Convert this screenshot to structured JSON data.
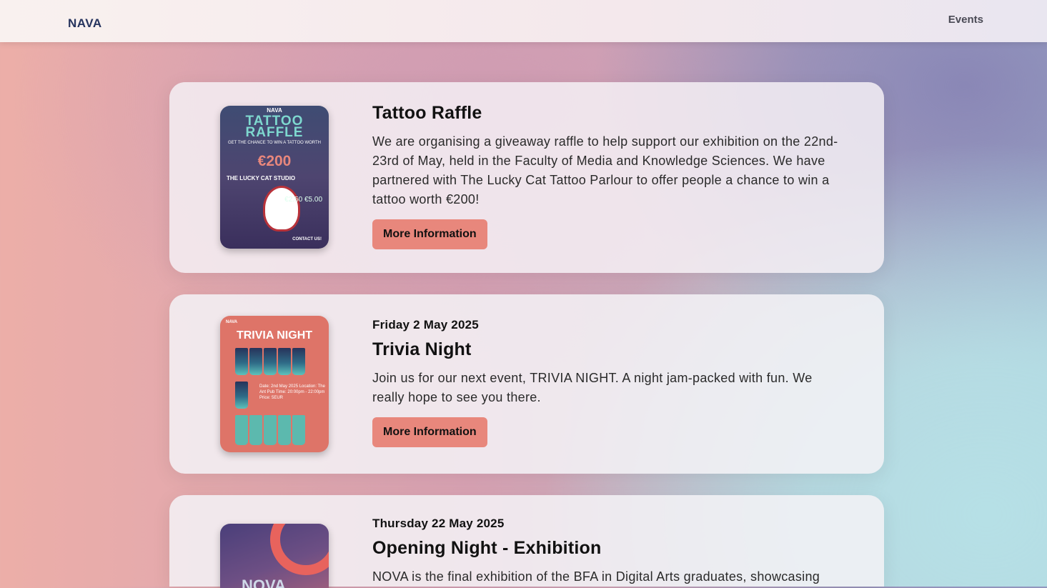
{
  "header": {
    "logo": "NAVA",
    "nav_events": "Events"
  },
  "events": [
    {
      "date": "",
      "title": "Tattoo Raffle",
      "description": "We are organising a giveaway raffle to help support our exhibition on the 22nd-23rd of May, held in the Faculty of Media and Knowledge Sciences. We have partnered with The Lucky Cat Tattoo Parlour to offer people a chance to win a tattoo worth €200!",
      "button": "More Information",
      "poster": {
        "brand": "NAVA",
        "title": "TATTOO RAFFLE",
        "tagline": "GET THE CHANCE TO WIN A TATTOO WORTH",
        "price": "€200",
        "studio": "THE LUCKY CAT STUDIO",
        "prices": "€2.50 €5.00",
        "contact": "CONTACT US!"
      }
    },
    {
      "date": "Friday 2 May 2025",
      "title": "Trivia Night",
      "description": "Join us for our next event, TRIVIA NIGHT. A night jam-packed with fun. We really hope to see you there.",
      "button": "More Information",
      "poster": {
        "brand": "NAVA",
        "title": "TRIVIA NIGHT",
        "info": "Date: 2nd May 2025 Location: The Ant Pub Time: 20:00pm - 22:00pm Price: 5EUR"
      }
    },
    {
      "date": "Thursday 22 May 2025",
      "title": "Opening Night - Exhibition",
      "description": "NOVA is the final exhibition of the BFA in Digital Arts graduates, showcasing",
      "button": "",
      "poster": {
        "brand": "NOVA"
      }
    }
  ]
}
